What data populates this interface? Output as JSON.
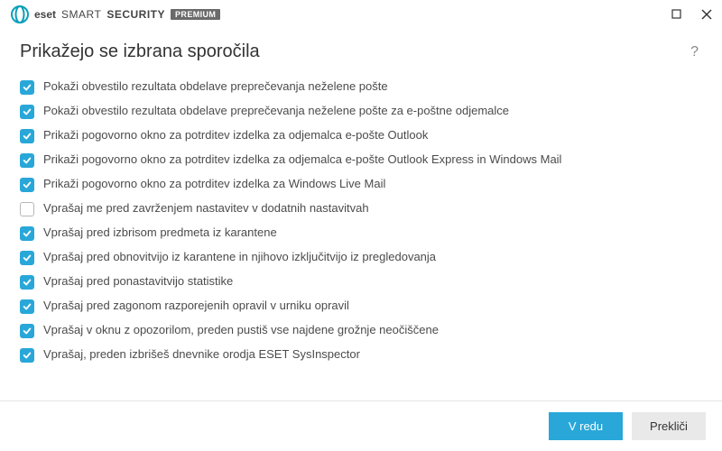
{
  "brand": {
    "eset": "eset",
    "product_light": "SMART",
    "product_bold": "SECURITY",
    "badge": "PREMIUM"
  },
  "header": {
    "title": "Prikažejo se izbrana sporočila",
    "help": "?"
  },
  "options": [
    {
      "checked": true,
      "label": "Pokaži obvestilo rezultata obdelave preprečevanja neželene pošte"
    },
    {
      "checked": true,
      "label": "Pokaži obvestilo rezultata obdelave preprečevanja neželene pošte za e-poštne odjemalce"
    },
    {
      "checked": true,
      "label": "Prikaži pogovorno okno za potrditev izdelka za odjemalca e-pošte Outlook"
    },
    {
      "checked": true,
      "label": "Prikaži pogovorno okno za potrditev izdelka za odjemalca e-pošte Outlook Express in Windows Mail"
    },
    {
      "checked": true,
      "label": "Prikaži pogovorno okno za potrditev izdelka za Windows Live Mail"
    },
    {
      "checked": false,
      "label": "Vprašaj me pred zavrženjem nastavitev v dodatnih nastavitvah"
    },
    {
      "checked": true,
      "label": "Vprašaj pred izbrisom predmeta iz karantene"
    },
    {
      "checked": true,
      "label": "Vprašaj pred obnovitvijo iz karantene in njihovo izključitvijo iz pregledovanja"
    },
    {
      "checked": true,
      "label": "Vprašaj pred ponastavitvijo statistike"
    },
    {
      "checked": true,
      "label": "Vprašaj pred zagonom razporejenih opravil v urniku opravil"
    },
    {
      "checked": true,
      "label": "Vprašaj v oknu z opozorilom, preden pustiš vse najdene grožnje neočiščene"
    },
    {
      "checked": true,
      "label": "Vprašaj, preden izbrišeš dnevnike orodja ESET SysInspector"
    }
  ],
  "footer": {
    "ok": "V redu",
    "cancel": "Prekliči"
  }
}
